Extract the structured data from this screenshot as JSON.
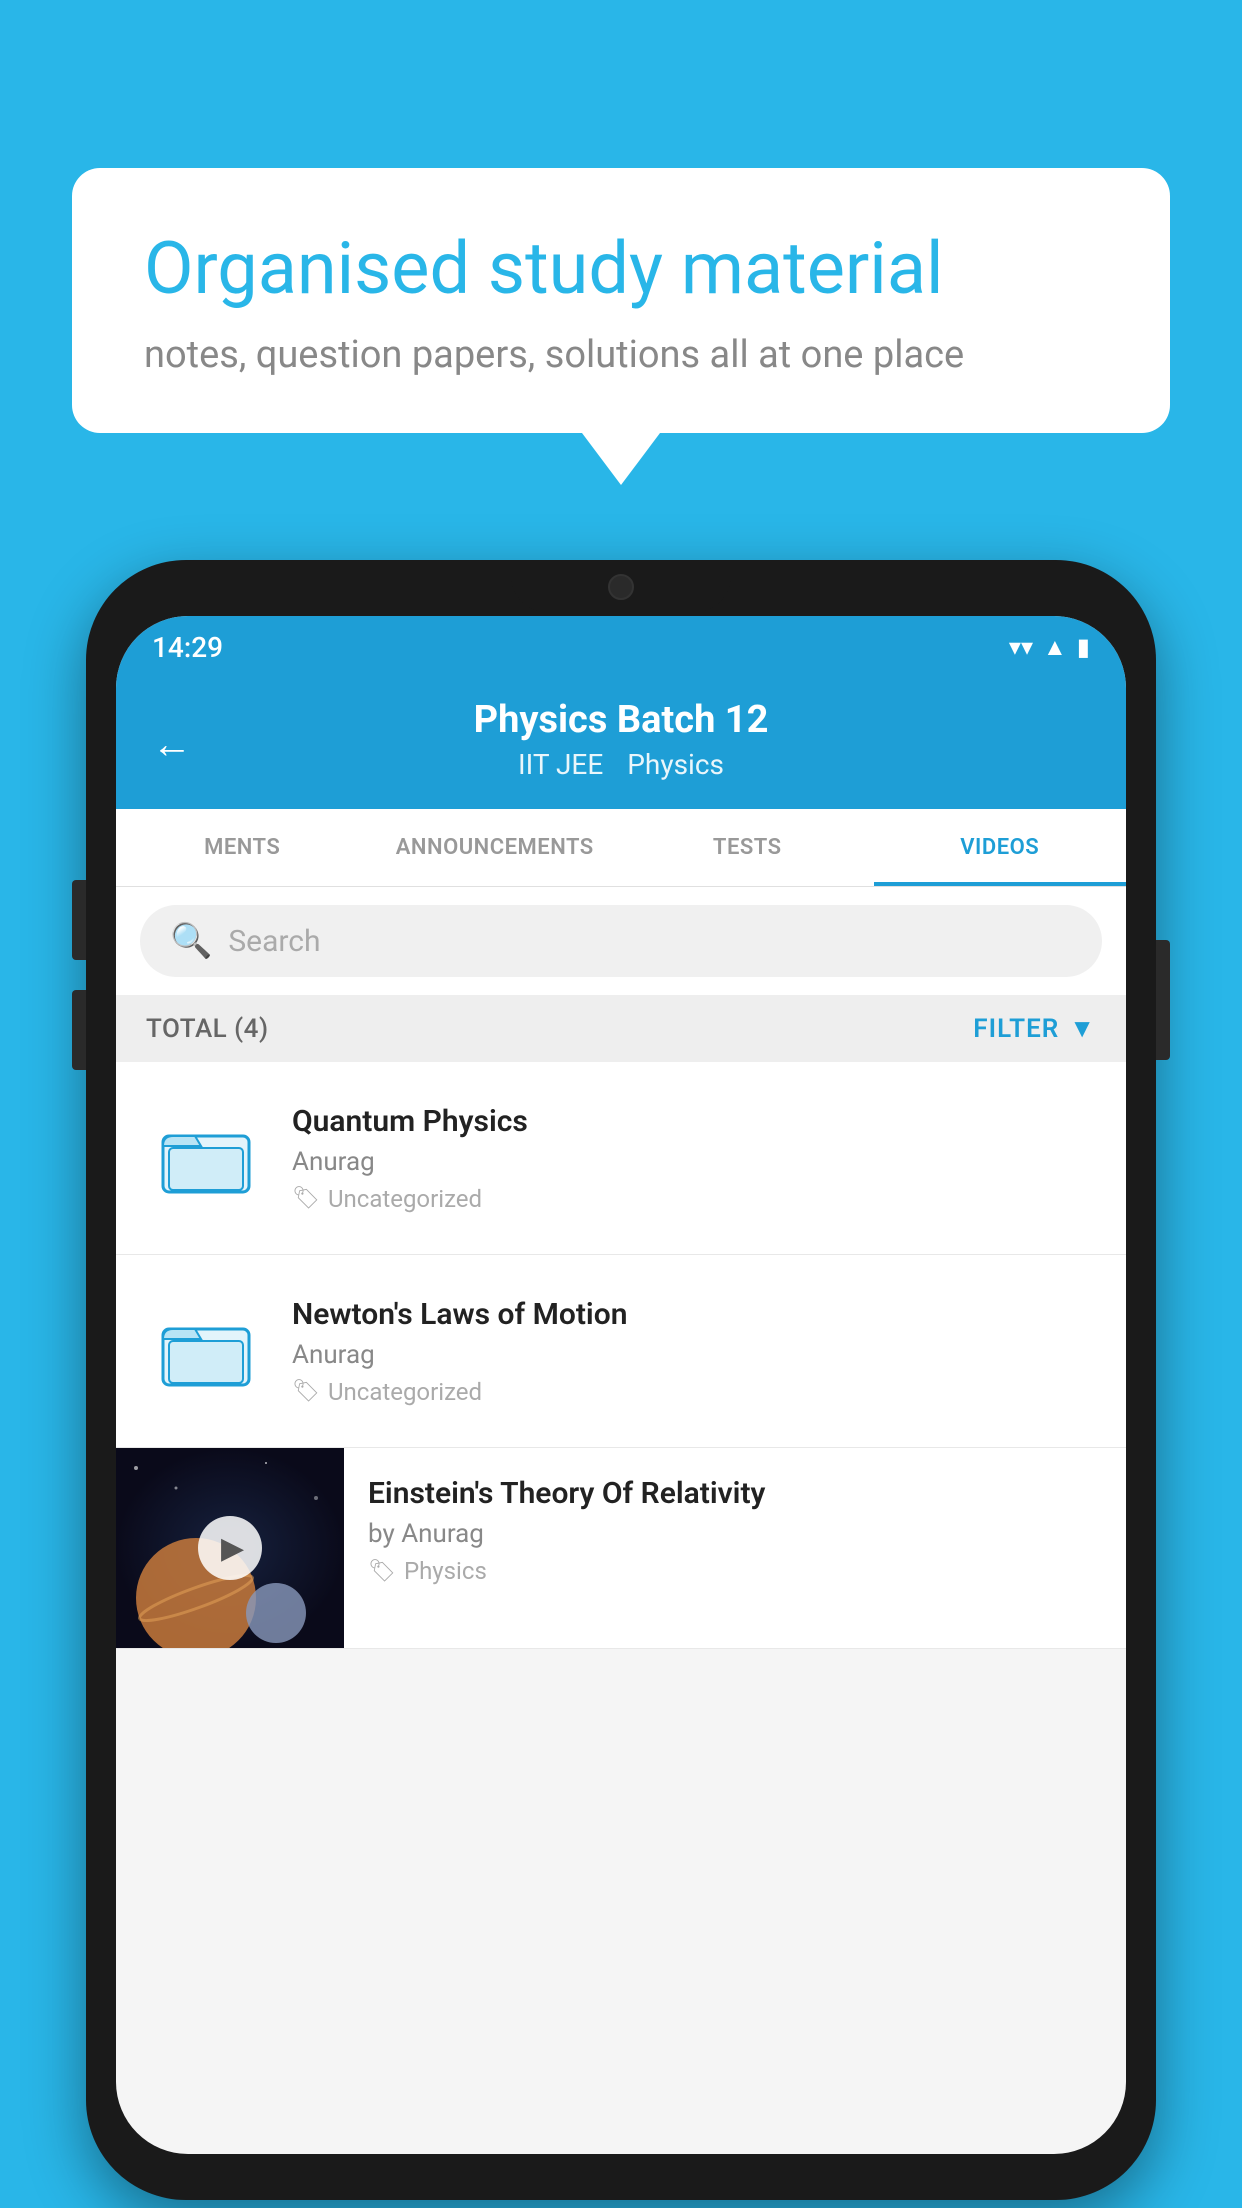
{
  "background_color": "#29b6e8",
  "bubble": {
    "title": "Organised study material",
    "subtitle": "notes, question papers, solutions all at one place"
  },
  "phone": {
    "status_bar": {
      "time": "14:29",
      "icons": [
        "wifi",
        "signal",
        "battery"
      ]
    },
    "header": {
      "back_label": "←",
      "title": "Physics Batch 12",
      "tag1": "IIT JEE",
      "tag2": "Physics"
    },
    "tabs": [
      {
        "label": "MENTS",
        "active": false
      },
      {
        "label": "ANNOUNCEMENTS",
        "active": false
      },
      {
        "label": "TESTS",
        "active": false
      },
      {
        "label": "VIDEOS",
        "active": true
      }
    ],
    "search": {
      "placeholder": "Search"
    },
    "filter_bar": {
      "total": "TOTAL (4)",
      "filter_label": "FILTER"
    },
    "videos": [
      {
        "title": "Quantum Physics",
        "author": "Anurag",
        "tag": "Uncategorized",
        "has_thumb": false
      },
      {
        "title": "Newton's Laws of Motion",
        "author": "Anurag",
        "tag": "Uncategorized",
        "has_thumb": false
      },
      {
        "title": "Einstein's Theory Of Relativity",
        "author": "by Anurag",
        "tag": "Physics",
        "has_thumb": true
      }
    ]
  }
}
